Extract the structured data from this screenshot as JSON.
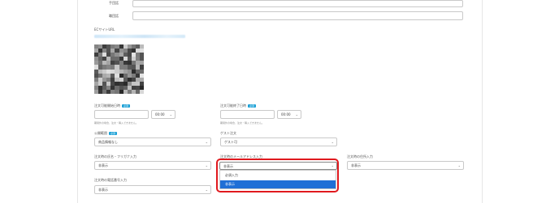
{
  "form": {
    "phone_label": "手団話",
    "fax_label": "職団話",
    "ec_url_label": "ECサイトURL",
    "order_start_label": "注文可能開始日時",
    "order_end_label": "注文可能終了日時",
    "required_badge": "必須",
    "order_start_time": "00:00",
    "order_end_time": "00:00",
    "order_start_note": "期間外の場合、注文・購入できません。",
    "order_end_note": "期間外の場合、注文・購入できません。",
    "public_scope_label": "公開範囲",
    "public_scope_value": "商品情報なし",
    "guest_order_label": "ゲスト注文",
    "guest_order_value": "ゲスト可",
    "name_kana_label": "注文時の氏名・フリガナ入力",
    "name_kana_value": "非表示",
    "email_label": "注文時のメールアドレス入力",
    "email_value": "非表示",
    "address_label": "注文時の住所入力",
    "address_value": "非表示",
    "phone_input_label": "注文時の電話番号入力",
    "phone_input_value": "非表示"
  },
  "dropdown": {
    "options": [
      "必須入力",
      "非表示"
    ],
    "selected_index": 1
  },
  "colors": {
    "badge": "#1aa0d6",
    "highlight": "#e0191e",
    "selected_option": "#1f6fd6"
  },
  "icons": {
    "chevron": "chevron-down-icon"
  }
}
